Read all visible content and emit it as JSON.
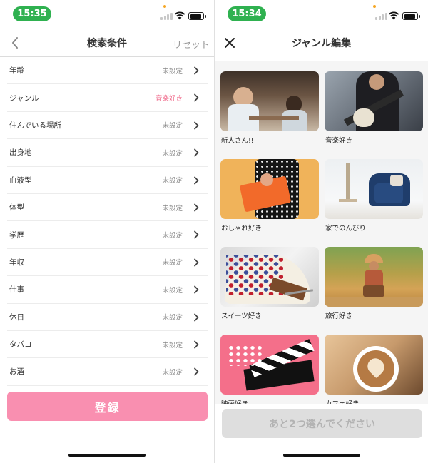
{
  "left": {
    "status": {
      "time": "15:35"
    },
    "nav": {
      "title": "検索条件",
      "reset": "リセット"
    },
    "conditions": [
      {
        "label": "年齢",
        "value": "未設定",
        "set": false
      },
      {
        "label": "ジャンル",
        "value": "音楽好き",
        "set": true
      },
      {
        "label": "住んでいる場所",
        "value": "未設定",
        "set": false
      },
      {
        "label": "出身地",
        "value": "未設定",
        "set": false
      },
      {
        "label": "血液型",
        "value": "未設定",
        "set": false
      },
      {
        "label": "体型",
        "value": "未設定",
        "set": false
      },
      {
        "label": "学歴",
        "value": "未設定",
        "set": false
      },
      {
        "label": "年収",
        "value": "未設定",
        "set": false
      },
      {
        "label": "仕事",
        "value": "未設定",
        "set": false
      },
      {
        "label": "休日",
        "value": "未設定",
        "set": false
      },
      {
        "label": "タバコ",
        "value": "未設定",
        "set": false
      },
      {
        "label": "お酒",
        "value": "未設定",
        "set": false
      }
    ],
    "register_label": "登録"
  },
  "right": {
    "status": {
      "time": "15:34"
    },
    "nav": {
      "title": "ジャンル編集"
    },
    "genres": [
      {
        "label": "新人さん!!",
        "image": "cafe-couple"
      },
      {
        "label": "音楽好き",
        "image": "guitar"
      },
      {
        "label": "おしゃれ好き",
        "image": "fashion"
      },
      {
        "label": "家でのんびり",
        "image": "home"
      },
      {
        "label": "スイーツ好き",
        "image": "sweets"
      },
      {
        "label": "旅行好き",
        "image": "travel"
      },
      {
        "label": "映画好き",
        "image": "movie"
      },
      {
        "label": "カフェ好き",
        "image": "cafe"
      }
    ],
    "submit_label": "あと2つ選んでください"
  },
  "colors": {
    "accent_pink": "#f98fb0",
    "set_value_pink": "#f06b8c",
    "status_green": "#2fb150",
    "disabled_gray": "#dedede"
  }
}
